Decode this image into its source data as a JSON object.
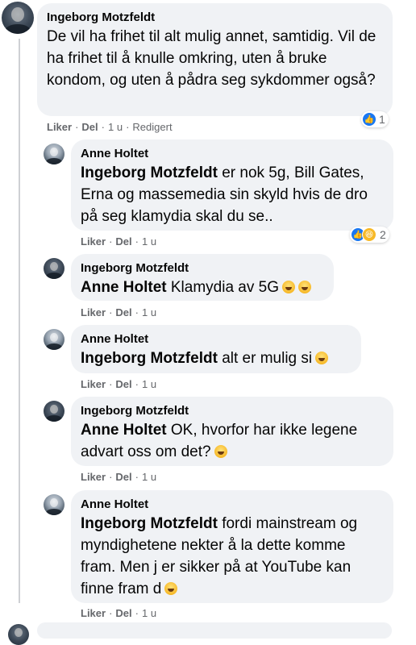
{
  "comments": [
    {
      "author": "Ingeborg Motzfeldt",
      "text": "De vil ha frihet til alt mulig annet, samtidig. Vil de ha frihet til å knulle omkring, uten å bruke kondom, og uten å pådra seg sykdommer også?",
      "actions": {
        "like": "Liker",
        "reply": "Del",
        "time": "1 u",
        "edited": "Redigert"
      },
      "reactions": {
        "types": [
          "like-icon"
        ],
        "count": "1"
      }
    }
  ],
  "replies": [
    {
      "author": "Anne Holtet",
      "mention": "Ingeborg Motzfeldt",
      "text": " er nok 5g, Bill Gates, Erna og massemedia sin skyld hvis de dro på seg klamydia skal du se..",
      "actions": {
        "like": "Liker",
        "reply": "Del",
        "time": "1 u"
      },
      "reactions": {
        "types": [
          "like-icon",
          "haha-icon"
        ],
        "count": "2"
      }
    },
    {
      "author": "Ingeborg Motzfeldt",
      "mention": "Anne Holtet",
      "text": " Klamydia av 5G",
      "emojis": [
        "laughing-emoji",
        "upside-down-emoji"
      ],
      "actions": {
        "like": "Liker",
        "reply": "Del",
        "time": "1 u"
      }
    },
    {
      "author": "Anne Holtet",
      "mention": "Ingeborg Motzfeldt",
      "text": " alt er mulig si",
      "emojis": [
        "laughing-emoji"
      ],
      "actions": {
        "like": "Liker",
        "reply": "Del",
        "time": "1 u"
      }
    },
    {
      "author": "Ingeborg Motzfeldt",
      "mention": "Anne Holtet",
      "text": " OK, hvorfor har ikke legene advart oss om det?",
      "emojis": [
        "laughing-emoji"
      ],
      "actions": {
        "like": "Liker",
        "reply": "Del",
        "time": "1 u"
      }
    },
    {
      "author": "Anne Holtet",
      "mention": "Ingeborg Motzfeldt",
      "text": " fordi mainstream og myndighetene nekter å la dette komme fram. Men j er sikker på at YouTube kan finne fram d",
      "emojis": [
        "grimacing-emoji"
      ],
      "actions": {
        "like": "Liker",
        "reply": "Del",
        "time": "1 u"
      }
    }
  ],
  "colors": {
    "bubble": "#f0f2f5",
    "secondary_text": "#65676b",
    "like_blue": "#1877f2",
    "haha_yellow": "#f7b928"
  }
}
